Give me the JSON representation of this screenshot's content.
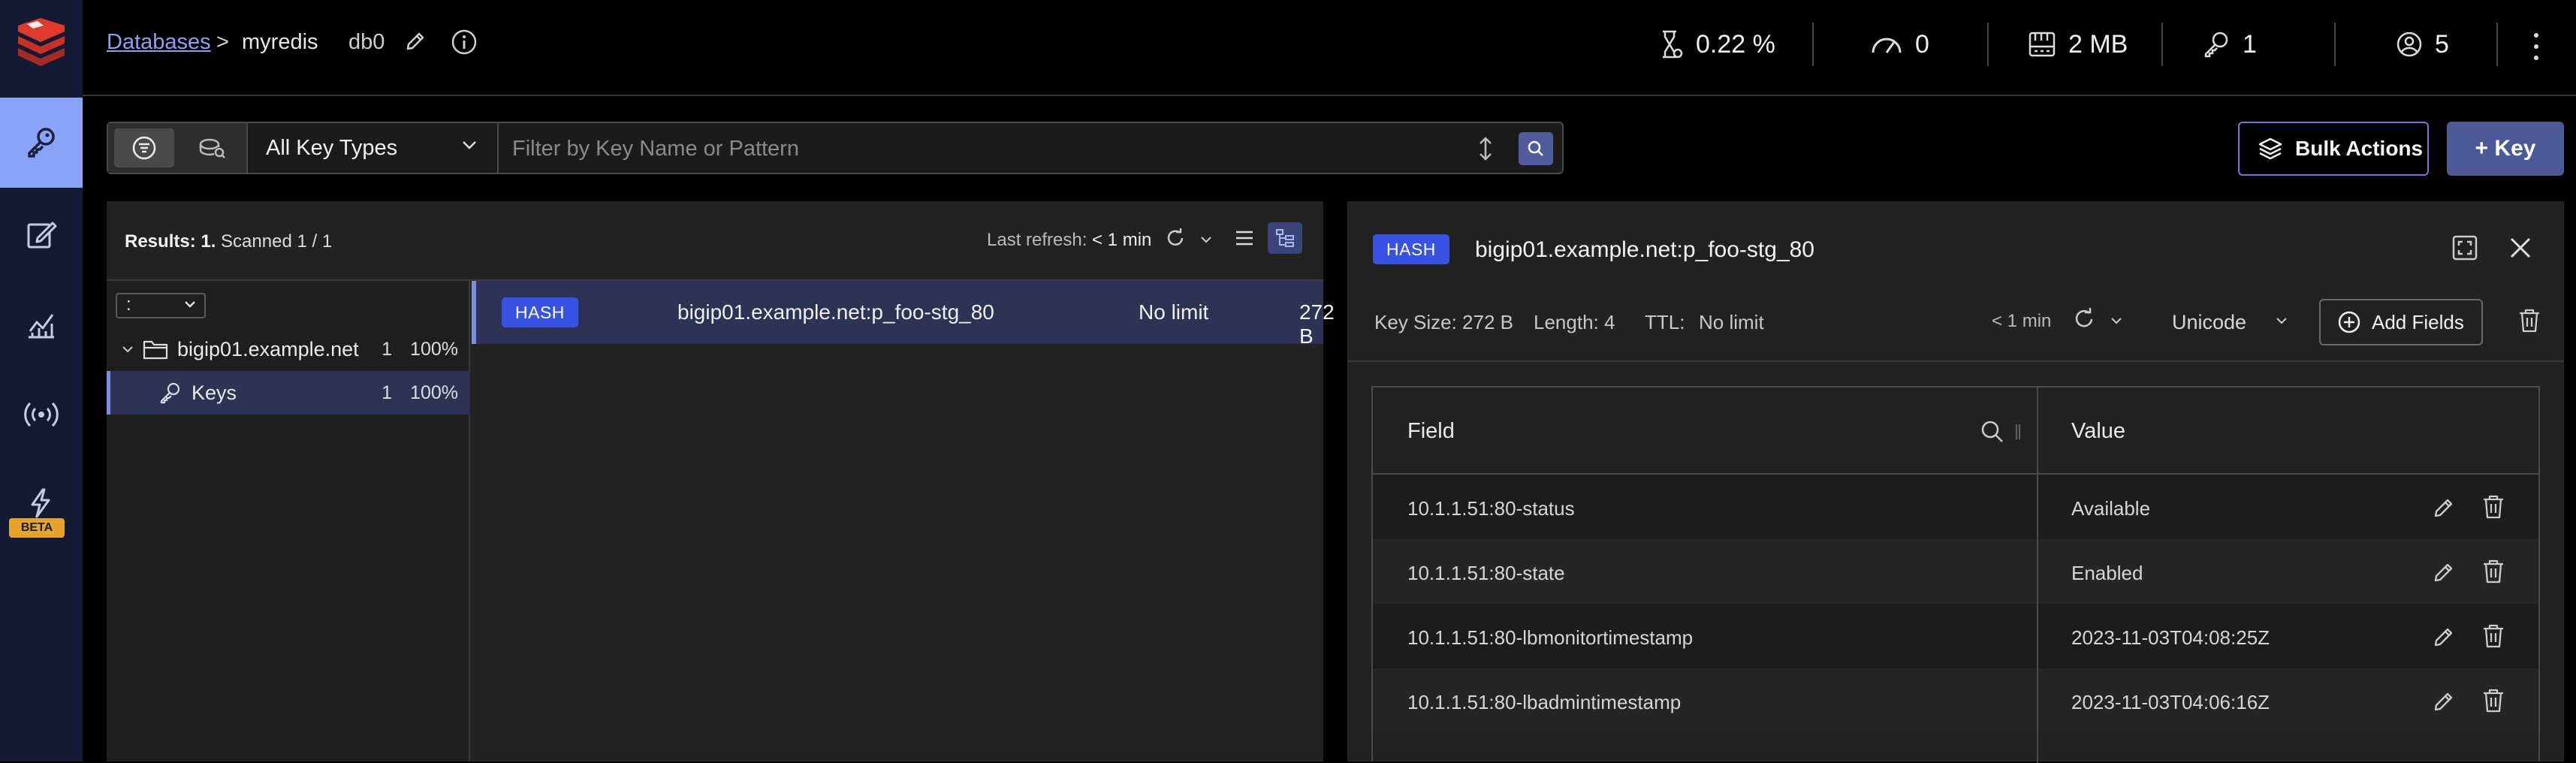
{
  "topbar": {
    "breadcrumb_link": "Databases",
    "breadcrumb_sep": ">",
    "db_name": "myredis",
    "db_index": "db0",
    "stats": {
      "cpu": "0.22 %",
      "ops": "0",
      "memory": "2 MB",
      "keys": "1",
      "clients": "5"
    }
  },
  "sidebar": {
    "items": [
      {
        "icon": "key-icon",
        "label": "Browser",
        "active": true
      },
      {
        "icon": "workbench-icon",
        "label": "Workbench"
      },
      {
        "icon": "analytics-icon",
        "label": "Analysis Tools"
      },
      {
        "icon": "pubsub-icon",
        "label": "Pub/Sub"
      },
      {
        "icon": "triggers-icon",
        "label": "Triggers and Functions"
      }
    ],
    "beta_label": "BETA"
  },
  "filter": {
    "key_type": "All Key Types",
    "placeholder": "Filter by Key Name or Pattern"
  },
  "actions": {
    "bulk_label": "Bulk Actions",
    "add_key_label": "+ Key"
  },
  "list": {
    "results_label": "Results: 1.",
    "scanned_label": "Scanned 1 / 1",
    "refresh_label": "Last refresh:",
    "refresh_value": "< 1 min",
    "delimiter": ":",
    "tree": [
      {
        "name": "bigip01.example.net",
        "count": "1",
        "percent": "100%"
      },
      {
        "name": "Keys",
        "count": "1",
        "percent": "100%"
      }
    ],
    "rows": [
      {
        "type": "HASH",
        "name": "bigip01.example.net:p_foo-stg_80",
        "ttl": "No limit",
        "size": "272 B"
      }
    ]
  },
  "detail": {
    "type": "HASH",
    "key_name": "bigip01.example.net:p_foo-stg_80",
    "key_size": "Key Size: 272 B",
    "length": "Length: 4",
    "ttl_label": "TTL:",
    "ttl_value": "No limit",
    "refresh_value": "< 1 min",
    "encoding": "Unicode",
    "add_fields_label": "Add Fields",
    "columns": {
      "field": "Field",
      "value": "Value"
    },
    "rows": [
      {
        "field": "10.1.1.51:80-status",
        "value": "Available"
      },
      {
        "field": "10.1.1.51:80-state",
        "value": "Enabled"
      },
      {
        "field": "10.1.1.51:80-lbmonitortimestamp",
        "value": "2023-11-03T04:08:25Z"
      },
      {
        "field": "10.1.1.51:80-lbadmintimestamp",
        "value": "2023-11-03T04:06:16Z"
      }
    ]
  },
  "colors": {
    "accent": "#8aa3f8",
    "badge_hash": "#3853e3",
    "selected_row": "#2c3355",
    "logo_red": "#d9342b",
    "beta": "#e8a32a"
  }
}
